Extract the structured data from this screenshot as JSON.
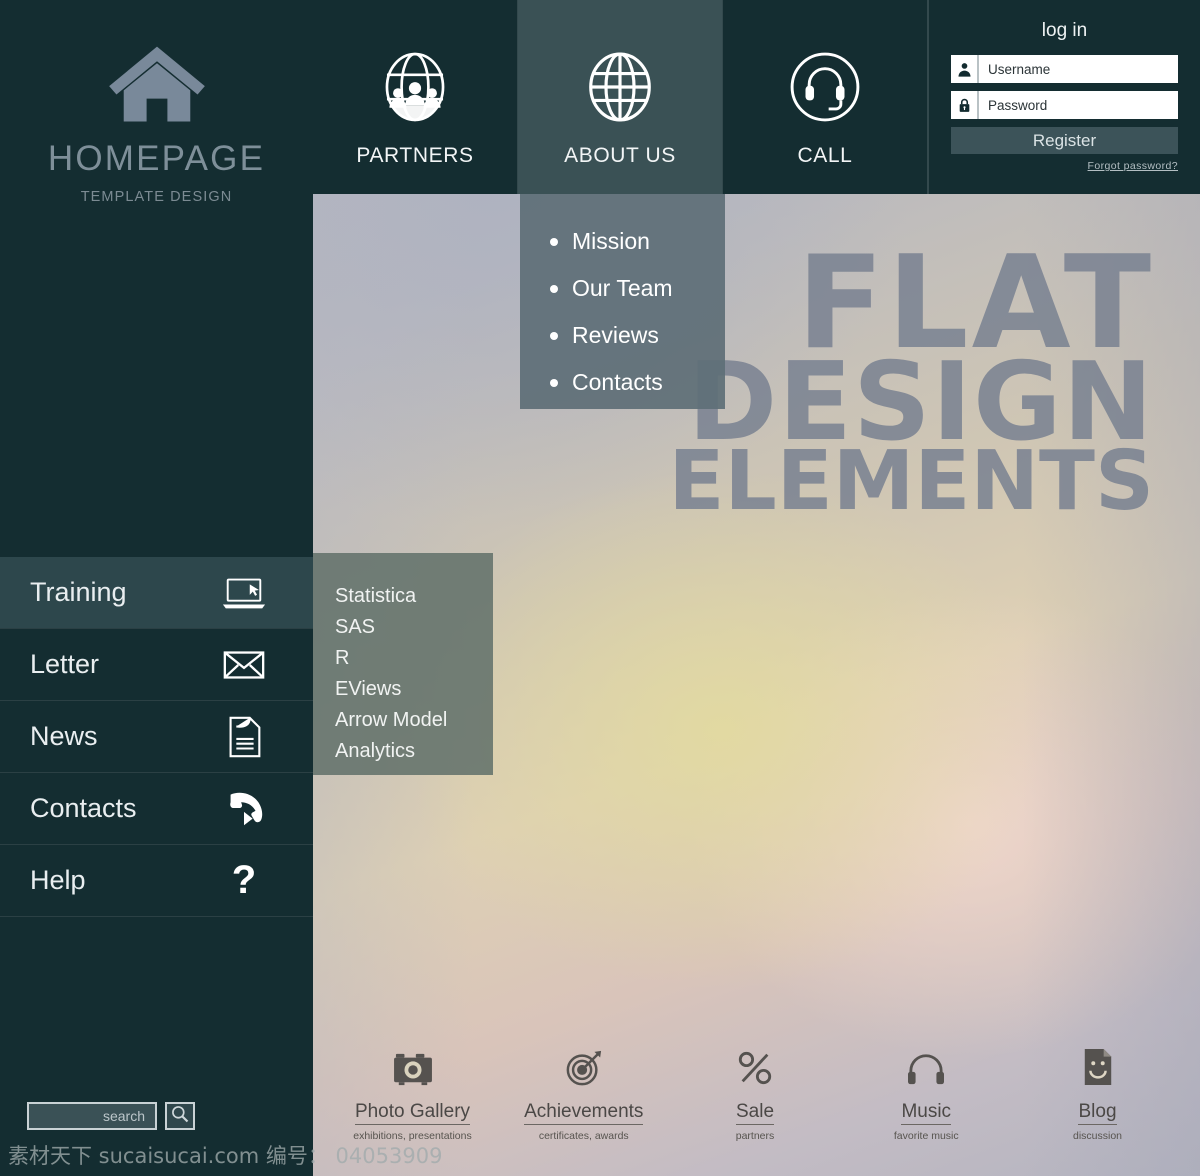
{
  "brand": {
    "icon": "house-icon",
    "title": "HOMEPAGE",
    "subtitle": "TEMPLATE DESIGN"
  },
  "topnav": {
    "tabs": [
      {
        "label": "PARTNERS",
        "icon": "globe-people-icon",
        "active": false
      },
      {
        "label": "ABOUT US",
        "icon": "globe-icon",
        "active": true
      },
      {
        "label": "CALL",
        "icon": "headset-icon",
        "active": false
      }
    ]
  },
  "login": {
    "title": "log in",
    "username_placeholder": "Username",
    "username_value": "",
    "username_icon": "user-icon",
    "password_placeholder": "Password",
    "password_value": "",
    "password_icon": "lock-icon",
    "register_label": "Register",
    "forgot_label": "Forgot  password?"
  },
  "dropdown": {
    "items": [
      {
        "label": "Mission"
      },
      {
        "label": "Our Team"
      },
      {
        "label": "Reviews"
      },
      {
        "label": "Contacts"
      }
    ]
  },
  "sidebar": {
    "items": [
      {
        "label": "Training",
        "icon": "laptop-icon",
        "active": true
      },
      {
        "label": "Letter",
        "icon": "envelope-icon",
        "active": false
      },
      {
        "label": "News",
        "icon": "document-icon",
        "active": false
      },
      {
        "label": "Contacts",
        "icon": "phone-icon",
        "active": false
      },
      {
        "label": "Help",
        "icon": "question-mark-icon",
        "active": false
      }
    ]
  },
  "submenu": {
    "items": [
      {
        "label": "Statistica"
      },
      {
        "label": "SAS"
      },
      {
        "label": "R"
      },
      {
        "label": "EViews"
      },
      {
        "label": "Arrow Model"
      },
      {
        "label": "Analytics"
      }
    ]
  },
  "hero": {
    "line1": "FLAT",
    "line2": "DESIGN",
    "line3": "ELEMENTS"
  },
  "features": [
    {
      "title": "Photo Gallery",
      "subtitle": "exhibitions, presentations",
      "icon": "camera-icon"
    },
    {
      "title": "Achievements",
      "subtitle": "certificates, awards",
      "icon": "target-icon"
    },
    {
      "title": "Sale",
      "subtitle": "partners",
      "icon": "percent-icon"
    },
    {
      "title": "Music",
      "subtitle": "favorite music",
      "icon": "headphones-icon"
    },
    {
      "title": "Blog",
      "subtitle": "discussion",
      "icon": "smiley-note-icon"
    }
  ],
  "search": {
    "value": "",
    "placeholder": "search",
    "icon": "magnifier-icon"
  },
  "watermark": {
    "text": "素材天下 sucaisucai.com  编号： 04053909"
  },
  "colors": {
    "sidebar_dark": "#142d31",
    "tab_active": "#3a5155",
    "dropdown_bg": "#5f6f77",
    "submenu_bg": "#63726b",
    "sidebar_active": "#2d474c",
    "hero_text": "#7b8392",
    "feature_text": "#4b4846"
  }
}
